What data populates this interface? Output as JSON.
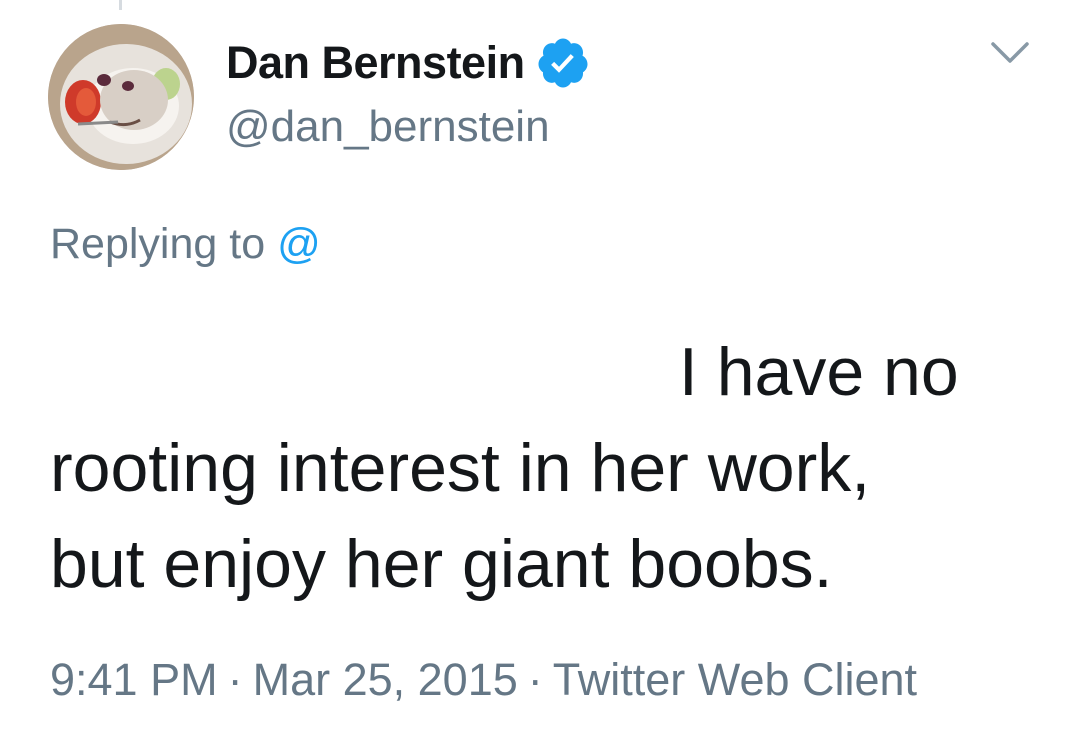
{
  "tweet": {
    "display_name": "Dan Bernstein",
    "handle": "@dan_bernstein",
    "replying_prefix": "Replying to",
    "replying_mention": "@",
    "body_line1": "I have no",
    "body_line2": "rooting interest in her work,",
    "body_line3": "but enjoy her giant boobs.",
    "time": "9:41 PM",
    "date": "Mar 25, 2015",
    "source": "Twitter Web Client",
    "separator": "·"
  },
  "icons": {
    "verified": "verified-badge-icon",
    "caret": "chevron-down-icon",
    "avatar": "avatar-image"
  },
  "colors": {
    "text": "#14171a",
    "secondary": "#657786",
    "accent": "#1da1f2"
  }
}
